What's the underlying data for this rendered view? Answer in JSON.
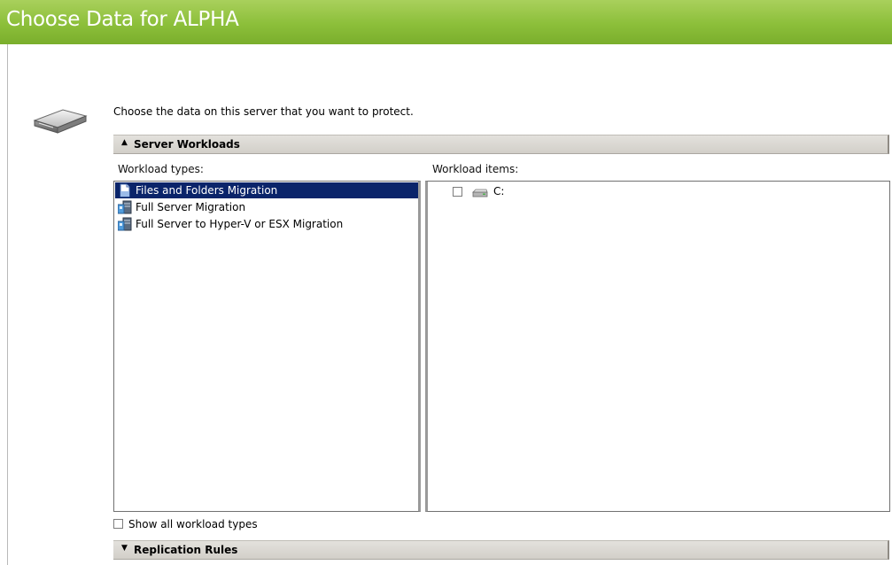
{
  "header": {
    "title": "Choose Data for ALPHA"
  },
  "intro": {
    "text": "Choose the data on this server that you want to protect."
  },
  "sections": {
    "server_workloads": {
      "label": "Server Workloads",
      "arrow": "▲"
    },
    "replication_rules": {
      "label": "Replication Rules",
      "arrow": "▼"
    }
  },
  "workload_types": {
    "label": "Workload types:",
    "items": [
      {
        "label": "Files and Folders Migration",
        "icon": "document-icon",
        "selected": true
      },
      {
        "label": "Full Server Migration",
        "icon": "server-icon",
        "selected": false
      },
      {
        "label": "Full Server to Hyper-V or ESX Migration",
        "icon": "server-icon",
        "selected": false
      }
    ]
  },
  "workload_items": {
    "label": "Workload items:",
    "items": [
      {
        "label": "C:",
        "checked": false,
        "icon": "drive-icon"
      }
    ]
  },
  "show_all": {
    "label": "Show all workload types",
    "checked": false
  },
  "colors": {
    "header_green": "#8cbf3a",
    "selection": "#0a246a",
    "section_bar": "#d8d5cf"
  }
}
